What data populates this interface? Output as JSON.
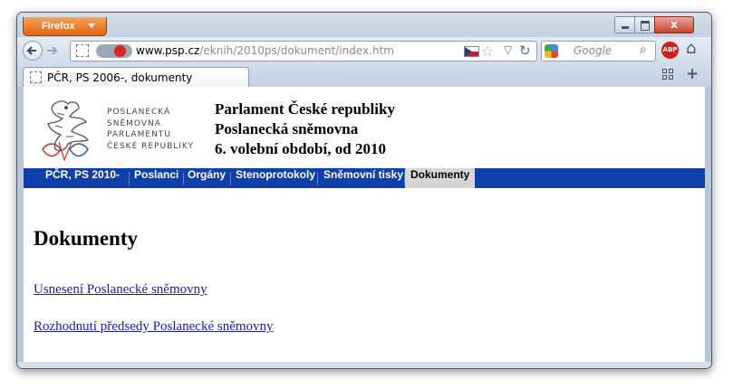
{
  "browser": {
    "menu_button_label": "Firefox",
    "close_glyph": "x",
    "url_domain": "www.psp.cz",
    "url_path": "/eknih/2010ps/dokument/index.htm",
    "search_engine": "Google",
    "search_placeholder": "Google",
    "adblock_label": "ABP",
    "tab_title": "PČR, PS 2006-, dokumenty",
    "new_tab_glyph": "+",
    "icons": [
      "back-icon",
      "forward-icon",
      "site-identity-icon",
      "stop-icon",
      "flag-cz-icon",
      "bookmark-star-icon",
      "reload-icon",
      "google-icon",
      "search-icon",
      "adblock-icon",
      "home-icon",
      "tab-list-icon",
      "new-tab-icon"
    ]
  },
  "site": {
    "logo_lines": [
      "POSLANECKÁ",
      "SNĚMOVNA",
      "PARLAMENTU",
      "ČESKÉ REPUBLIKY"
    ],
    "header_lines": [
      "Parlament České republiky",
      "Poslanecká sněmovna",
      "6. volební období, od 2010"
    ],
    "nav": [
      "PČR, PS 2010-",
      "Poslanci",
      "Orgány",
      "Stenoprotokoly",
      "Sněmovní tisky",
      "Dokumenty"
    ],
    "active_nav": "Dokumenty",
    "nav_color": "#0f3fa8"
  },
  "page": {
    "heading": "Dokumenty",
    "links": [
      "Usnesení Poslanecké sněmovny",
      "Rozhodnutí předsedy Poslanecké sněmovny"
    ]
  }
}
